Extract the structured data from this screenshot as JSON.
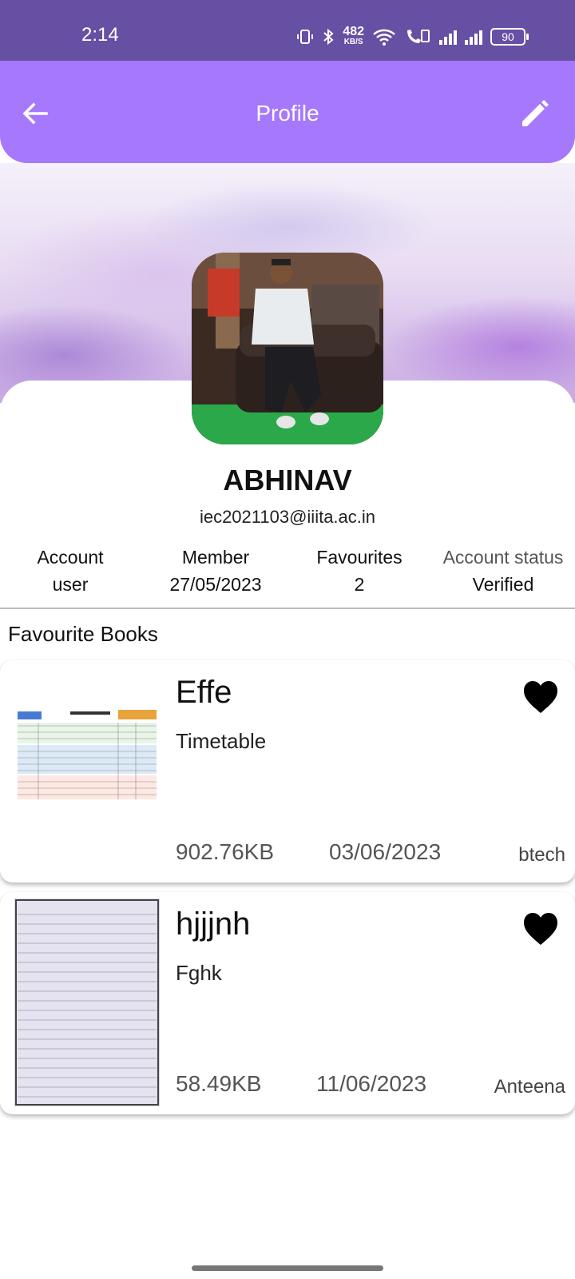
{
  "status_bar": {
    "time": "2:14",
    "net_speed_value": "482",
    "net_speed_unit": "KB/S",
    "battery": "90"
  },
  "app_bar": {
    "title": "Profile",
    "back_icon": "arrow-left-icon",
    "edit_icon": "pencil-icon"
  },
  "profile": {
    "name": "ABHINAV",
    "email": "iec2021103@iiita.ac.in",
    "stats": [
      {
        "label": "Account",
        "value": "user"
      },
      {
        "label": "Member",
        "value": "27/05/2023"
      },
      {
        "label": "Favourites",
        "value": "2"
      },
      {
        "label": "Account status",
        "value": "Verified"
      }
    ]
  },
  "favourites": {
    "section_title": "Favourite Books",
    "books": [
      {
        "title": "Effe",
        "description": "Timetable",
        "size": "902.76KB",
        "date": "03/06/2023",
        "category": "btech",
        "favourite_icon": "heart-filled-icon"
      },
      {
        "title": "hjjjnh",
        "description": "Fghk",
        "size": "58.49KB",
        "date": "11/06/2023",
        "category": "Anteena",
        "favourite_icon": "heart-filled-icon"
      }
    ]
  },
  "colors": {
    "status_bar": "#6650a4",
    "app_bar": "#a678fb"
  }
}
